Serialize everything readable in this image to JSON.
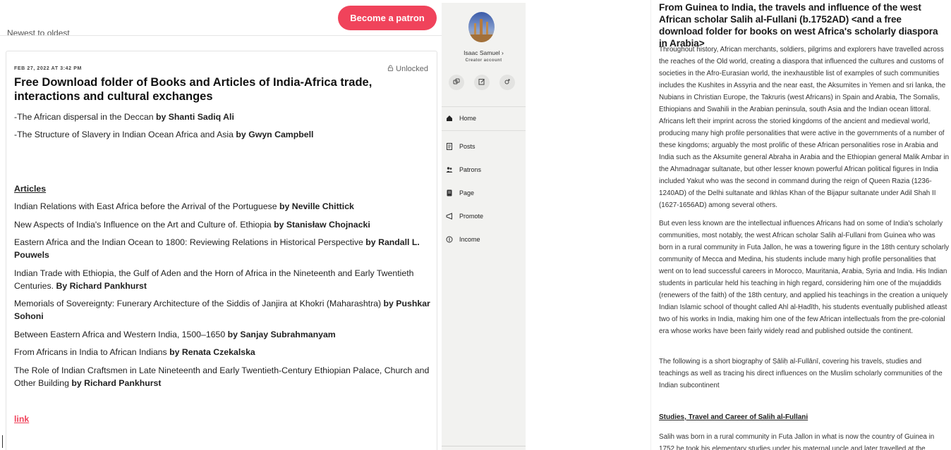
{
  "left": {
    "cut_text": "Newest to oldest",
    "patron_button": "Become a patron",
    "post": {
      "date": "FEB 27, 2022 AT 3:42 PM",
      "unlocked": "Unlocked",
      "title": "Free Download folder of Books and Articles of India-Africa trade, interactions and cultural exchanges",
      "books": [
        {
          "text": "-The African dispersal in the Deccan ",
          "author": "by Shanti Sadiq Ali"
        },
        {
          "text": "-The Structure of Slavery in Indian Ocean Africa and Asia ",
          "author": "by Gwyn Campbell"
        }
      ],
      "articles_heading": "Articles",
      "articles": [
        {
          "text": "Indian Relations with East Africa before the Arrival of the Portuguese ",
          "author": "by Neville Chittick"
        },
        {
          "text": "New Aspects of India's Influence on the Art and Culture of. Ethiopia ",
          "author": "by Stanisław Chojnacki"
        },
        {
          "text": "Eastern Africa and the Indian Ocean to 1800: Reviewing Relations in Historical Perspective ",
          "author": "by Randall L. Pouwels"
        },
        {
          "text": "Indian Trade with Ethiopia, the Gulf of Aden and the Horn of Africa in the Nineteenth and Early Twentieth Centuries. ",
          "author": "By Richard Pankhurst"
        },
        {
          "text": "Memorials of Sovereignty: Funerary Architecture of the Siddis of Janjira at Khokri (Maharashtra) ",
          "author": "by Pushkar Sohoni"
        },
        {
          "text": "Between Eastern Africa and Western India, 1500–1650 ",
          "author": "by Sanjay Subrahmanyam"
        },
        {
          "text": "From Africans in India to African Indians ",
          "author": "by Renata Czekalska"
        },
        {
          "text": "The Role of Indian Craftsmen in Late Nineteenth and Early Twentieth-Century Ethiopian Palace, Church and Other Building ",
          "author": "by Richard Pankhurst"
        }
      ],
      "link_label": "link"
    }
  },
  "sidebar": {
    "creator_name": "Isaac Samuel ›",
    "creator_role": "Creator account",
    "nav": [
      {
        "label": "Home",
        "icon": "home-icon"
      },
      {
        "label": "Posts",
        "icon": "posts-icon"
      },
      {
        "label": "Patrons",
        "icon": "patrons-icon"
      },
      {
        "label": "Page",
        "icon": "page-icon"
      },
      {
        "label": "Promote",
        "icon": "promote-icon"
      },
      {
        "label": "Income",
        "icon": "income-icon"
      }
    ]
  },
  "article": {
    "title": "From Guinea to India, the travels and influence of the west African scholar Salih al-Fullani (b.1752AD) <and a free download folder for books on west Africa's scholarly diaspora in Arabia>",
    "paragraphs": [
      "Throughout history, African merchants, soldiers, pilgrims and explorers have travelled across the reaches of the Old world, creating a diaspora that influenced the cultures and customs of societies in the Afro-Eurasian world, the inexhaustible list of examples of such communities includes the Kushites in Assyria and the near east, the Aksumites in Yemen and sri lanka, the Nubians in Christian Europe, the Takruris (west Africans) in Spain and Arabia, The Somalis, Ethiopians and Swahili in the Arabian peninsula, south Asia and the Indian ocean littoral. Africans left their imprint across the storied kingdoms of the ancient and medieval world, producing many high profile personalities that were active in the governments of a number of these kingdoms; arguably the most prolific of these African personalities rose in Arabia and India such as the Aksumite general Abraha in Arabia and the Ethiopian general Malik Ambar in the Ahmadnagar sultanate, but other lesser known powerful African political figures in India included Yakut who was the second in command during the reign of Queen Razia (1236-1240AD) of the Delhi sultanate and Ikhlas Khan of the Bijapur sultanate under Adil Shah II (1627-1656AD) among several others.",
      "But even less known are the intellectual influences Africans had on some of India's scholarly communities, most notably, the west African scholar Salih al-Fullani from Guinea who was born in a rural community in Futa Jallon, he was a towering figure in the 18th century scholarly community of Mecca and Medina, his students include many high profile personalities that went on to lead successful careers in Morocco, Mauritania, Arabia, Syria and India. His Indian students in particular held his teaching in high regard, considering him one of the mujaddids (renewers of the faith) of the 18th century, and applied his teachings in the creation a uniquely Indian Islamic school of thought called Ahl al-Ḥadīth, his students eventually published atleast two of his works in India, making him one of the few African intellectuals from the pre-colonial era whose works have been fairly widely read and published outside the continent.",
      "The following is a short biography of Ṣāliḥ al-Fullānī, covering his travels, studies and teachings as well as tracing his direct influences on the Muslim scholarly communities of the Indian subcontinent"
    ],
    "section_heading": "Studies, Travel and Career of Salih al-Fullani",
    "section_text": "Salih was born in a rural community in Futa Jallon in what is now the country of Guinea in 1752 he took his elementary studies under his maternal uncle and later travelled at the"
  }
}
